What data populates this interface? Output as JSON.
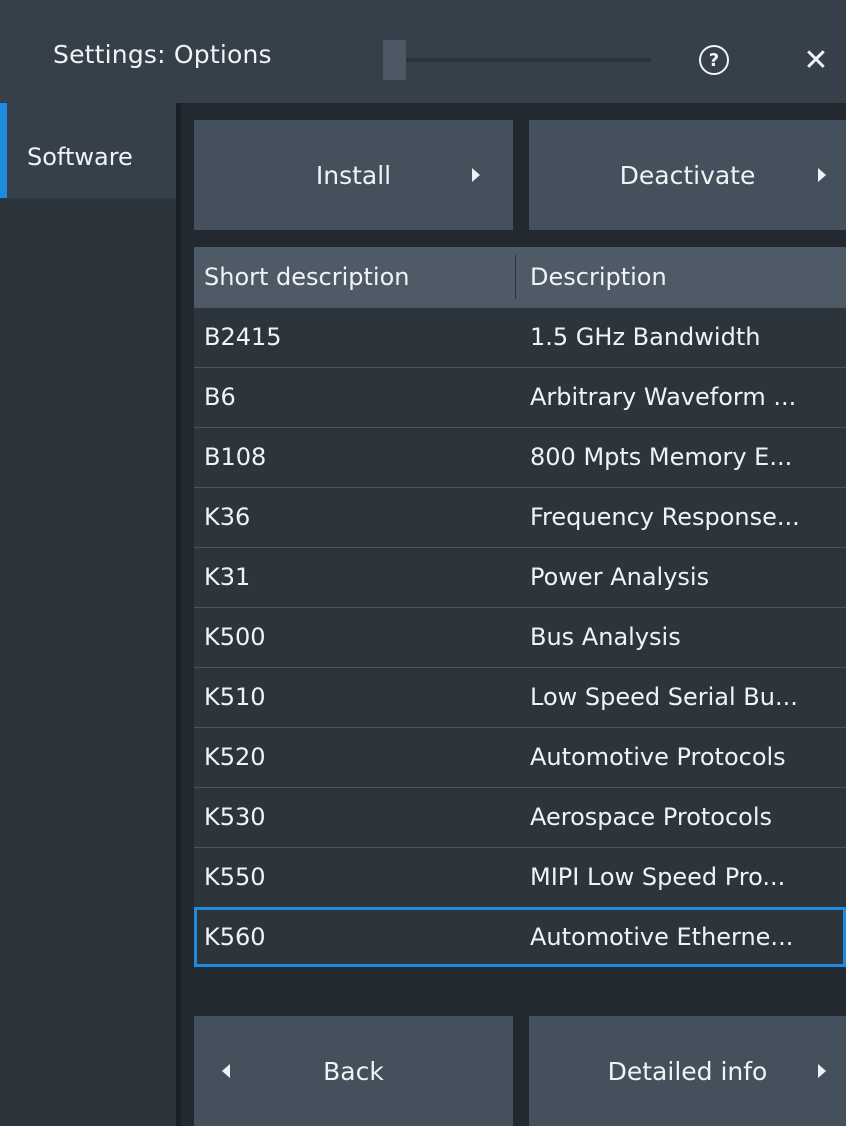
{
  "window": {
    "title": "Settings: Options",
    "help_label": "?",
    "close_label": "✕"
  },
  "sidebar": {
    "items": [
      {
        "label": "Software",
        "selected": true
      }
    ]
  },
  "actions": {
    "install_label": "Install",
    "deactivate_label": "Deactivate",
    "back_label": "Back",
    "detailed_info_label": "Detailed info"
  },
  "table": {
    "columns": [
      "Short description",
      "Description"
    ],
    "rows": [
      [
        "B2415",
        "1.5 GHz Bandwidth"
      ],
      [
        "B6",
        "Arbitrary Waveform ..."
      ],
      [
        "B108",
        "800 Mpts Memory E..."
      ],
      [
        "K36",
        "Frequency Response..."
      ],
      [
        "K31",
        "Power Analysis"
      ],
      [
        "K500",
        "Bus Analysis"
      ],
      [
        "K510",
        "Low Speed Serial Bu..."
      ],
      [
        "K520",
        "Automotive Protocols"
      ],
      [
        "K530",
        "Aerospace Protocols"
      ],
      [
        "K550",
        "MIPI Low Speed Pro..."
      ],
      [
        "K560",
        "Automotive Etherne..."
      ]
    ],
    "selected_row_index": 10
  },
  "colors": {
    "accent": "#1e8ae0",
    "background": "#1b2026",
    "button": "#44505c",
    "header": "#4e5a66",
    "row": "#2c343c"
  }
}
